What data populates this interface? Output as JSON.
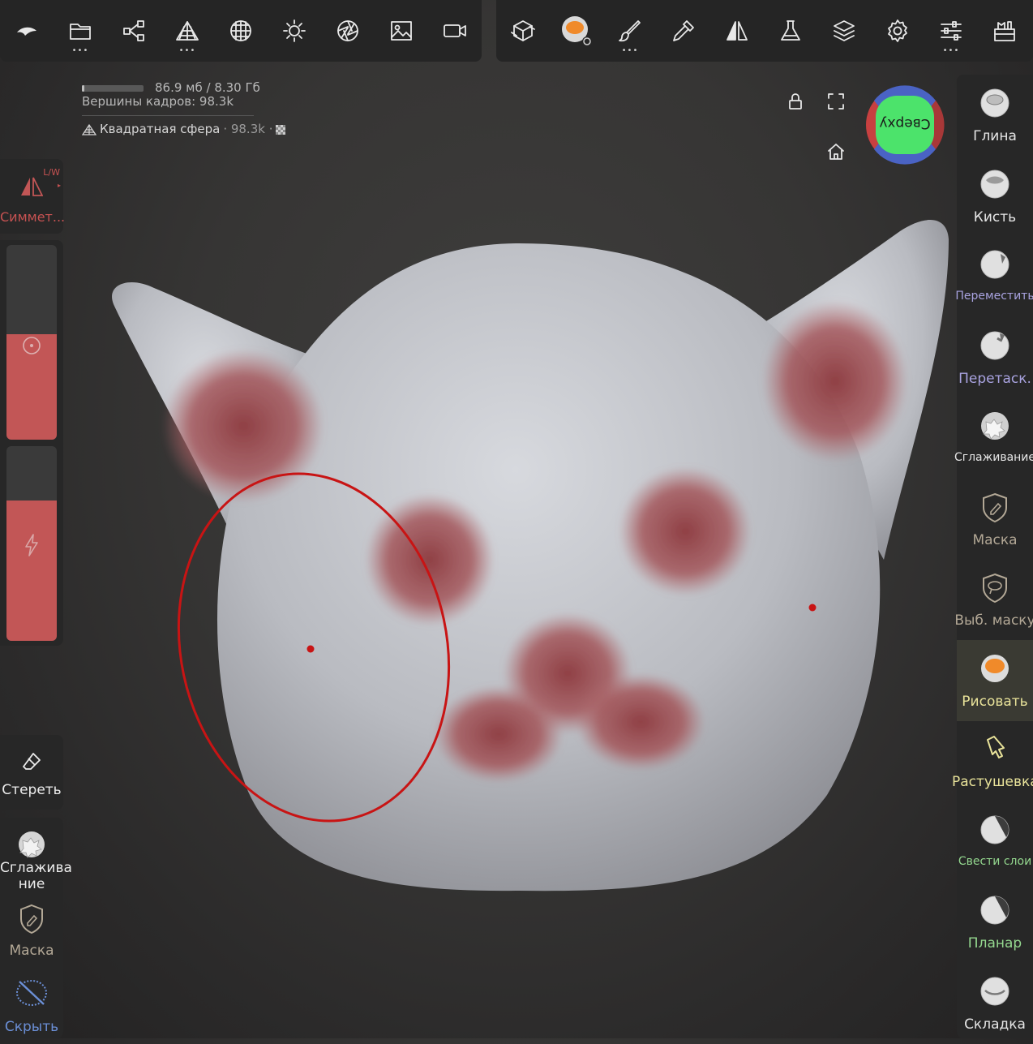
{
  "toolbar_left": [
    {
      "name": "logo-icon",
      "dots": false
    },
    {
      "name": "folder-icon",
      "dots": true
    },
    {
      "name": "scene-tree-icon",
      "dots": false
    },
    {
      "name": "topology-icon",
      "dots": true
    },
    {
      "name": "material-sphere-icon",
      "dots": false
    },
    {
      "name": "sun-icon",
      "dots": false
    },
    {
      "name": "aperture-icon",
      "dots": false
    },
    {
      "name": "image-icon",
      "dots": false
    },
    {
      "name": "video-camera-icon",
      "dots": false
    }
  ],
  "toolbar_right": [
    {
      "name": "cube-transform-icon",
      "dots": false
    },
    {
      "name": "paint-material-ball-icon",
      "dots": false
    },
    {
      "name": "brush-icon",
      "dots": true
    },
    {
      "name": "pipette-icon",
      "dots": false
    },
    {
      "name": "symmetry-icon",
      "dots": false
    },
    {
      "name": "flask-icon",
      "dots": false
    },
    {
      "name": "layers-icon",
      "dots": false
    },
    {
      "name": "gear-icon",
      "dots": false
    },
    {
      "name": "sliders-icon",
      "dots": true
    },
    {
      "name": "toolbox-icon",
      "dots": false
    }
  ],
  "stats": {
    "memory": "86.9 мб / 8.30 Гб",
    "vertices": "Вершины кадров: 98.3k",
    "mesh_name": "Квадратная сфера",
    "mesh_meta": "· 98.3k ·",
    "memory_fraction": 0.01
  },
  "gizmo_label": "Сверху",
  "left": {
    "symmetry_label": "Симмет...",
    "symmetry_tag": "L/W",
    "radius_fraction": 0.54,
    "intensity_fraction": 0.72,
    "erase_label": "Стереть",
    "smooth_label_1": "Сглажива",
    "smooth_label_2": "ние",
    "mask_label": "Маска",
    "hide_label": "Скрыть"
  },
  "right_tools": [
    {
      "label": "Глина",
      "color": "#e6e6e6",
      "icon": "clay-ball-icon"
    },
    {
      "label": "Кисть",
      "color": "#e6e6e6",
      "icon": "brush-ball-icon"
    },
    {
      "label": "Переместить",
      "color": "#a9a3e0",
      "icon": "move-ball-icon"
    },
    {
      "label": "Перетаск.",
      "color": "#a9a3e0",
      "icon": "drag-ball-icon"
    },
    {
      "label": "Сглаживание",
      "color": "#e6e6e6",
      "icon": "smooth-ball-icon"
    },
    {
      "label": "Маска",
      "color": "#b3a896",
      "icon": "mask-shield-icon"
    },
    {
      "label": "Выб. маску",
      "color": "#b3a896",
      "icon": "select-mask-icon"
    },
    {
      "label": "Рисовать",
      "color": "#e9e39a",
      "icon": "paint-ball-icon"
    },
    {
      "label": "Растушевка",
      "color": "#e9e39a",
      "icon": "smudge-icon"
    },
    {
      "label": "Свести слои",
      "color": "#94d88f",
      "icon": "flatten-layers-ball-icon"
    },
    {
      "label": "Планар",
      "color": "#94d88f",
      "icon": "planar-ball-icon"
    },
    {
      "label": "Складка",
      "color": "#e6e6e6",
      "icon": "crease-ball-icon"
    }
  ],
  "colors": {
    "panel": "#272727",
    "accent_red": "#c25656",
    "selected_tool_bg": "#3a3a33",
    "brush_ring": "#c81414"
  }
}
